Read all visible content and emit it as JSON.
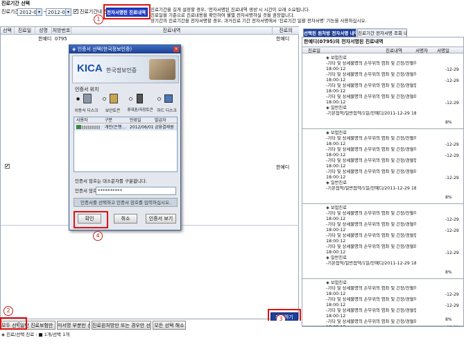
{
  "header": {
    "title": "진료기간 선택",
    "period_label": "진료기간",
    "date_from": "2012-02-13",
    "date_to": "2012-02-13",
    "checkbox_label": "진료기간내 진료내",
    "create_button": "전자서명된 진료내역 생성",
    "notice_lines": [
      "진료기간을 길게 설정할 경우, '전자서명된 진료내역 생성'시 시간이 오래 소요됩니다.",
      "진료일을 기준으로 진료내용을 확인하여 월별 전자서명하실 것을 권장합니다.",
      "장기간의 진료기간을 전자서명할 경우, 과거진료 기간 전자서명에서 '진료기간 일괄 전자서명' 기능을 사용하십시오."
    ]
  },
  "left_table": {
    "columns": [
      "선택",
      "진료일",
      "성명",
      "처방번호",
      "진료내역",
      "진료의"
    ],
    "first_row": {
      "name": "한예디",
      "rx": "0795",
      "detail": "진료일정",
      "doctor": "한예디"
    },
    "doctor_row2": "한예디"
  },
  "dialog": {
    "title": "인증서 선택(한국정보인증)",
    "brand": "한국정보인증",
    "brand_logo": "KICA",
    "location_label": "인증서 위치",
    "locations": [
      {
        "label": "이동식 디스크",
        "icon": "usb-drive-icon"
      },
      {
        "label": "보안토큰",
        "icon": "security-token-icon"
      },
      {
        "label": "휴대폰/저장토큰",
        "icon": "phone-icon"
      },
      {
        "label": "하드 디스크",
        "icon": "hard-disk-icon"
      }
    ],
    "cert_columns": [
      "사용자",
      "구분",
      "만료일",
      "발급자"
    ],
    "cert_row": [
      "",
      "개인(은행...",
      "2012/06/01",
      "금융결제원"
    ],
    "password_hint": "인증서 암호는 대소문자를 구분합니다.",
    "password_label": "인증서 암호",
    "password_value": "**********",
    "status_msg": "인증서를 선택하고 인증서 암호를 입력하십시오.",
    "buttons": {
      "ok": "확인",
      "cancel": "취소",
      "view": "인증서 보기"
    }
  },
  "right_panel": {
    "tabs": [
      "선택된 원처방 전자서명 내역",
      "진료기간 전자서명 조회 내역"
    ],
    "subtitle": "한예디(0795)의 전자서명된 진료내역",
    "columns": [
      "진료일",
      "진료내역",
      "서명자",
      "서명일"
    ],
    "record_lines": [
      "◈ 보험진료",
      "-기타 및 상세불명의 손부위의 염좌 및 긴장/진펄어",
      "18:00:12",
      "-기타 및 상세불명의 손부위의 염좌 및 긴장/경혈어제",
      "18:00:12",
      "-기타 및 상세불명의 손부위의 염좌 및 긴장/경혈업",
      "18:00:12",
      "-기타 및 상세불명의 손부위의 염좌 및 긴장/경혈파 II",
      "18:00:12",
      "◈ 일반진료",
      "-기본첩약/일반첩약/1일/한예디/2011-12-29 18:00"
    ],
    "date_tag": "-12-29",
    "tag_end": "8%",
    "confirm_button": "제출하기"
  },
  "bottom": {
    "buttons": [
      "모두 선택",
      "일반 진료보험만 선택",
      "미서명 부분만 선택",
      "진료원처방만 또는 경우만 선택",
      "모든 선택 해소"
    ],
    "status": "◈ 진료/선택 진료 : ■ 1개/선택 1개"
  },
  "callouts": [
    "1",
    "2",
    "3",
    "4"
  ]
}
